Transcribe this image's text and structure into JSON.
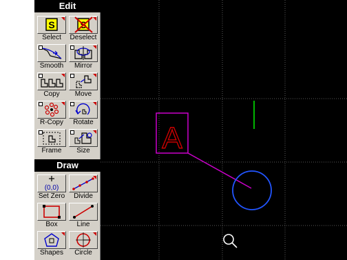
{
  "toolbar": {
    "edit_title": "Edit",
    "draw_title": "Draw",
    "tools": {
      "select": "Select",
      "deselect": "Deselect",
      "smooth": "Smooth",
      "mirror": "Mirror",
      "copy": "Copy",
      "move": "Move",
      "rcopy": "R-Copy",
      "rotate": "Rotate",
      "frame": "Frame",
      "size": "Size",
      "setzero": "Set Zero",
      "divide": "Divide",
      "box": "Box",
      "line": "Line",
      "shapes": "Shapes",
      "circle": "Circle"
    }
  },
  "canvas": {
    "text_object": "A",
    "colors": {
      "background": "#000000",
      "grid": "#5a5a5a",
      "selection": "#cc00cc",
      "text": "#cc0000",
      "circle": "#2255ff",
      "line": "#00cc00"
    }
  }
}
